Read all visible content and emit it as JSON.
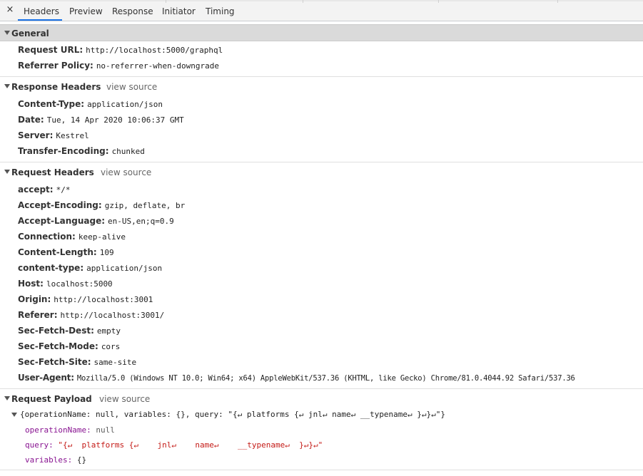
{
  "tabs": {
    "close": "×",
    "items": [
      "Headers",
      "Preview",
      "Response",
      "Initiator",
      "Timing"
    ],
    "active": "Headers"
  },
  "general": {
    "title": "General",
    "rows": [
      {
        "key": "Request URL:",
        "value": "http://localhost:5000/graphql"
      },
      {
        "key": "Referrer Policy:",
        "value": "no-referrer-when-downgrade"
      }
    ]
  },
  "response_headers": {
    "title": "Response Headers",
    "view_source": "view source",
    "rows": [
      {
        "key": "Content-Type:",
        "value": "application/json"
      },
      {
        "key": "Date:",
        "value": "Tue, 14 Apr 2020 10:06:37 GMT"
      },
      {
        "key": "Server:",
        "value": "Kestrel"
      },
      {
        "key": "Transfer-Encoding:",
        "value": "chunked"
      }
    ]
  },
  "request_headers": {
    "title": "Request Headers",
    "view_source": "view source",
    "rows": [
      {
        "key": "accept:",
        "value": "*/*"
      },
      {
        "key": "Accept-Encoding:",
        "value": "gzip, deflate, br"
      },
      {
        "key": "Accept-Language:",
        "value": "en-US,en;q=0.9"
      },
      {
        "key": "Connection:",
        "value": "keep-alive"
      },
      {
        "key": "Content-Length:",
        "value": "109"
      },
      {
        "key": "content-type:",
        "value": "application/json"
      },
      {
        "key": "Host:",
        "value": "localhost:5000"
      },
      {
        "key": "Origin:",
        "value": "http://localhost:3001"
      },
      {
        "key": "Referer:",
        "value": "http://localhost:3001/"
      },
      {
        "key": "Sec-Fetch-Dest:",
        "value": "empty"
      },
      {
        "key": "Sec-Fetch-Mode:",
        "value": "cors"
      },
      {
        "key": "Sec-Fetch-Site:",
        "value": "same-site"
      },
      {
        "key": "User-Agent:",
        "value": "Mozilla/5.0 (Windows NT 10.0; Win64; x64) AppleWebKit/537.36 (KHTML, like Gecko) Chrome/81.0.4044.92 Safari/537.36"
      }
    ]
  },
  "request_payload": {
    "title": "Request Payload",
    "view_source": "view source",
    "summary": "{operationName: null, variables: {}, query: \"{↵ platforms {↵ jnl↵ name↵ __typename↵ }↵}↵\"}",
    "props": [
      {
        "key": "operationName",
        "value": "null",
        "kind": "null"
      },
      {
        "key": "query",
        "value": "\"{↵  platforms {↵    jnl↵    name↵    __typename↵  }↵}↵\"",
        "kind": "string"
      },
      {
        "key": "variables",
        "value": "{}",
        "kind": "object"
      }
    ]
  }
}
